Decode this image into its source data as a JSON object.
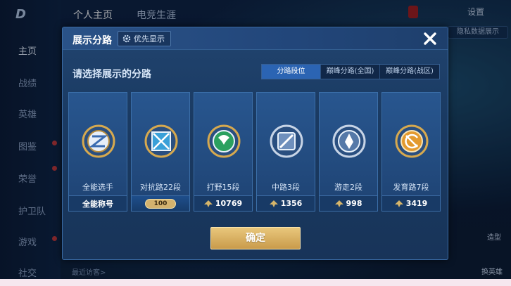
{
  "sidebar": {
    "items": [
      {
        "label": "主页",
        "active": true
      },
      {
        "label": "战绩"
      },
      {
        "label": "英雄"
      },
      {
        "label": "图鉴"
      },
      {
        "label": "荣誉"
      },
      {
        "label": "护卫队"
      },
      {
        "label": "游戏"
      },
      {
        "label": "社交"
      }
    ]
  },
  "topbar": {
    "tabs": [
      "个人主页",
      "电竞生涯"
    ],
    "settings_label": "设置",
    "right_chip": "隐私数据展示"
  },
  "bottom": {
    "recent_visitors": "最近访客>",
    "switch_hero": "换英雄",
    "top_right_label": "造型"
  },
  "modal": {
    "title": "展示分路",
    "priority_label": "优先显示",
    "prompt": "请选择展示的分路",
    "segments": [
      "分路段位",
      "巅峰分路(全国)",
      "巅峰分路(战区)"
    ],
    "cards": [
      {
        "name": "全能选手",
        "footer": "全能称号",
        "emblem": "all-round-emblem"
      },
      {
        "name": "对抗路22段",
        "footer": "100",
        "emblem": "clash-lane-emblem"
      },
      {
        "name": "打野15段",
        "footer": "10769",
        "emblem": "jungle-emblem"
      },
      {
        "name": "中路3段",
        "footer": "1356",
        "emblem": "mid-lane-emblem"
      },
      {
        "name": "游走2段",
        "footer": "998",
        "emblem": "roam-emblem"
      },
      {
        "name": "发育路7段",
        "footer": "3419",
        "emblem": "farm-lane-emblem"
      }
    ],
    "confirm_label": "确定"
  },
  "colors": {
    "modal_bg": "#1a3a62",
    "active_segment": "#2b64b3",
    "confirm_gold": "#d9b165",
    "emblem_gold": "#d6a94f"
  }
}
